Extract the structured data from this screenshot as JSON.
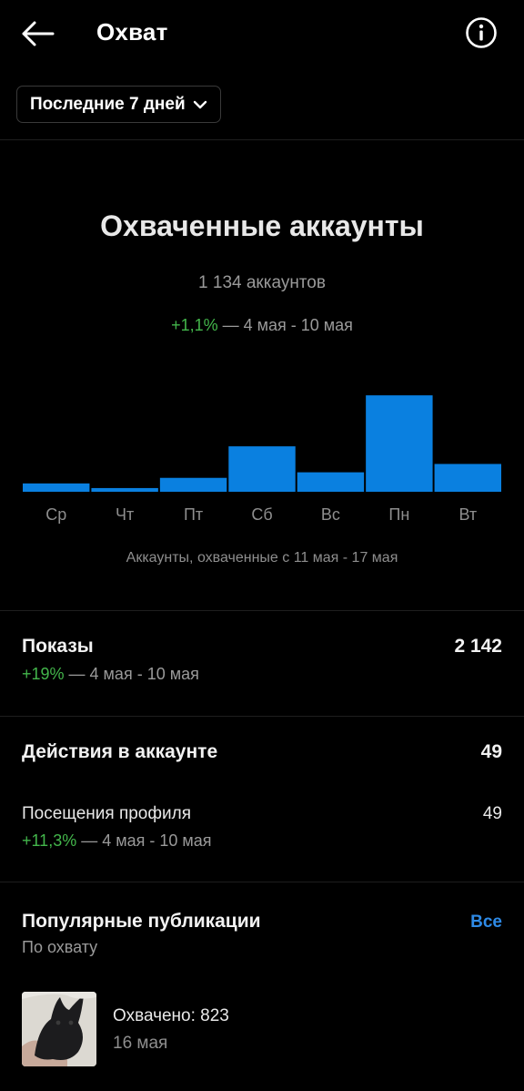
{
  "header": {
    "title": "Охват",
    "back_icon": "arrow-left-icon",
    "info_icon": "info-circle-icon"
  },
  "filter": {
    "label": "Последние 7 дней",
    "icon": "chevron-down-icon"
  },
  "reach": {
    "title": "Охваченные аккаунты",
    "accounts": "1 134 аккаунтов",
    "change": "+1,1%",
    "period": " — 4 мая - 10 мая"
  },
  "chart_data": {
    "type": "bar",
    "categories": [
      "Ср",
      "Чт",
      "Пт",
      "Сб",
      "Вс",
      "Пн",
      "Вт"
    ],
    "values": [
      9,
      4,
      15,
      49,
      21,
      104,
      30
    ],
    "ylim": [
      0,
      110
    ],
    "caption": "Аккаунты, охваченные с 11 мая - 17 мая",
    "color": "#0a80e0",
    "grid": false
  },
  "impressions": {
    "label": "Показы",
    "value": "2 142",
    "change": "+19%",
    "period": " — 4 мая - 10 мая"
  },
  "actions": {
    "label": "Действия в аккаунте",
    "value": "49"
  },
  "profile_visits": {
    "label": "Посещения профиля",
    "value": "49",
    "change": "+11,3%",
    "period": " — 4 мая - 10 мая"
  },
  "popular": {
    "title": "Популярные публикации",
    "subtitle": "По охвату",
    "all_label": "Все",
    "posts": [
      {
        "reach": "Охвачено: 823",
        "date": "16 мая"
      }
    ]
  },
  "colors": {
    "accent_blue": "#0a80e0",
    "link_blue": "#2e8ae6",
    "positive_green": "#43b64b",
    "background": "#000000"
  }
}
